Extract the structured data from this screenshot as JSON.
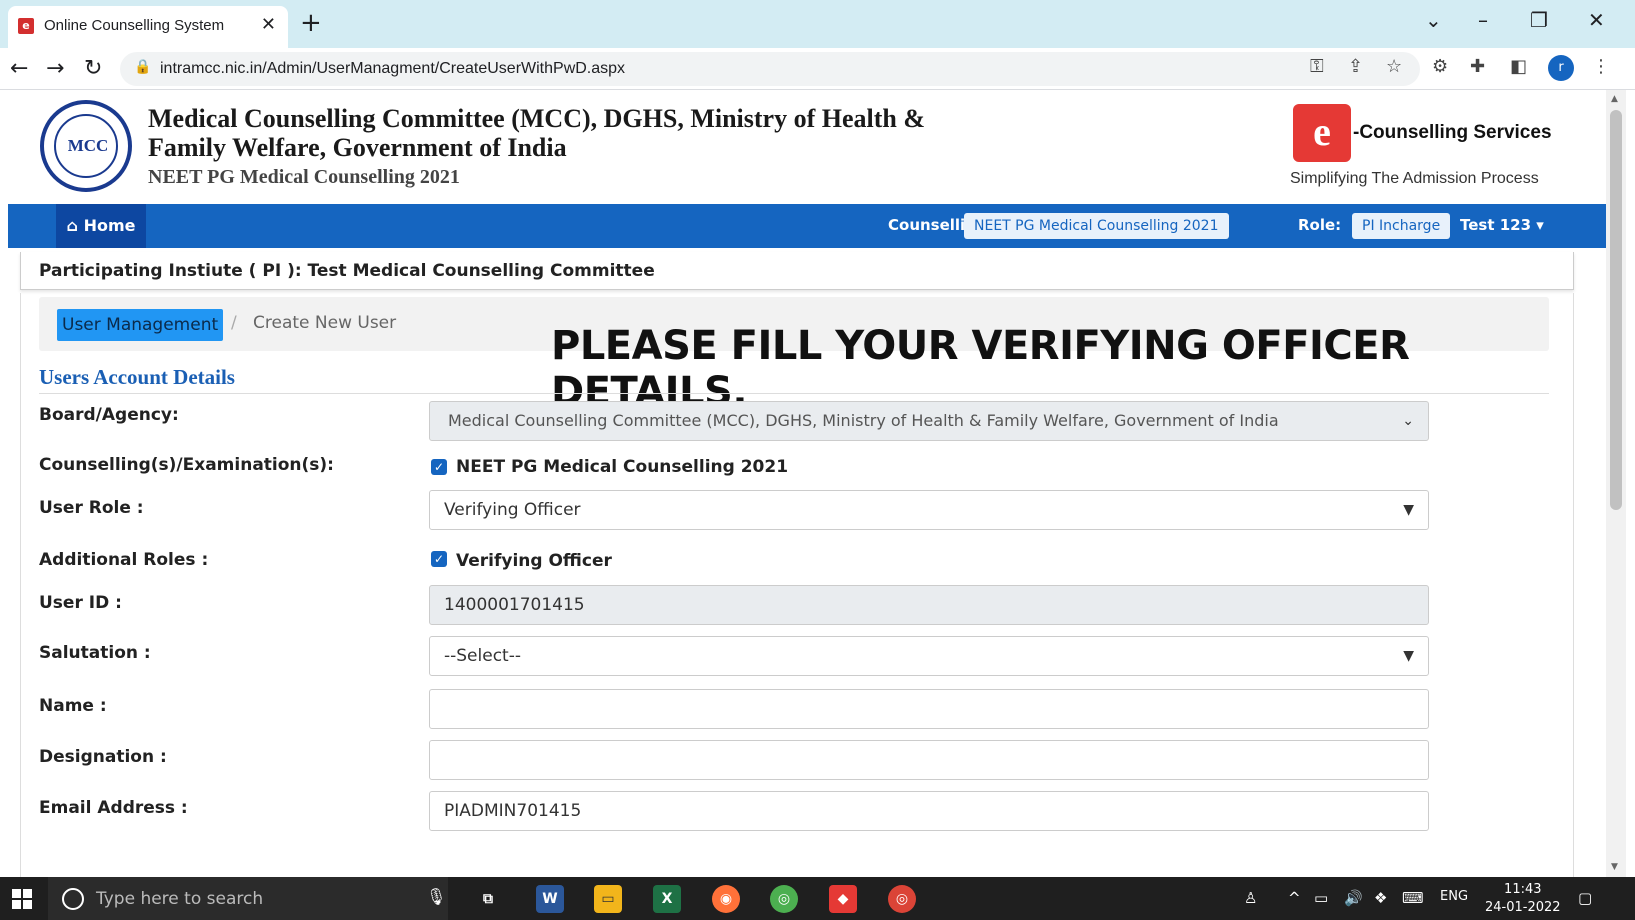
{
  "browser": {
    "tab_title": "Online Counselling System",
    "url": "intramcc.nic.in/Admin/UserManagment/CreateUserWithPwD.aspx"
  },
  "header": {
    "logo_text": "MCC",
    "org_title": "Medical Counselling Committee (MCC), DGHS, Ministry of Health & Family Welfare, Government of India",
    "sub_title": "NEET PG Medical Counselling 2021",
    "ec_logo": "e",
    "ec_name": "-Counselling Services",
    "ec_tagline": "Simplifying The Admission Process"
  },
  "navbar": {
    "home_label": "Home",
    "counselling_label": "Counselling :",
    "counselling_value": "NEET PG Medical Counselling 2021",
    "role_label": "Role:",
    "role_value": "PI Incharge",
    "user_label": "Test 123"
  },
  "pi_bar": {
    "text": "Participating Instiute ( PI ): Test Medical Counselling Committee"
  },
  "breadcrumb": {
    "root": "User Management",
    "separator": "/",
    "current": "Create New User"
  },
  "notice": "PLEASE FILL YOUR VERIFYING OFFICER DETAILS.",
  "section_title": "Users Account Details",
  "form": {
    "board_label": "Board/Agency:",
    "board_value": "Medical Counselling Committee (MCC), DGHS, Ministry of Health & Family Welfare, Government of India",
    "counselling_label": "Counselling(s)/Examination(s):",
    "counselling_option": "NEET PG Medical Counselling 2021",
    "counselling_checked": true,
    "role_label": "User Role :",
    "role_value": "Verifying Officer",
    "additional_roles_label": "Additional Roles :",
    "additional_role_option": "Verifying Officer",
    "additional_role_checked": true,
    "userid_label": "User ID :",
    "userid_value": "1400001701415",
    "salutation_label": "Salutation :",
    "salutation_value": "--Select--",
    "name_label": "Name :",
    "name_value": "",
    "designation_label": "Designation :",
    "designation_value": "",
    "email_label": "Email Address :",
    "email_value": "PIADMIN701415"
  },
  "taskbar": {
    "search_placeholder": "Type here to search",
    "language": "ENG",
    "time": "11:43",
    "date": "24-01-2022"
  },
  "colors": {
    "navbar": "#1565c0",
    "home_active": "#0d47a1",
    "breadcrumb_active": "#2196f3",
    "section_title": "#1a5fb4"
  }
}
